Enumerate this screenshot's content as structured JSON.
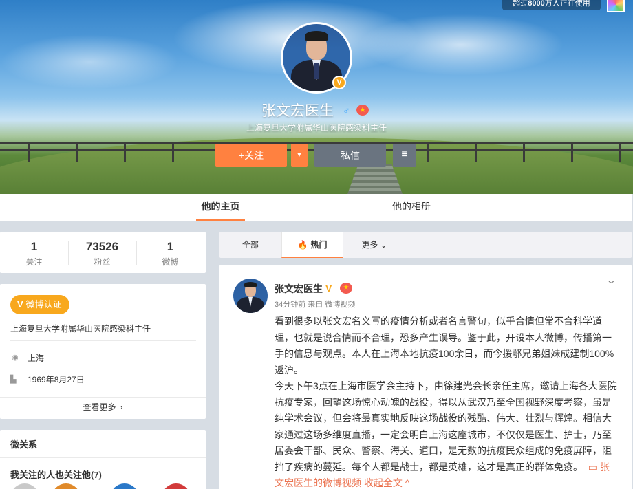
{
  "banner": {
    "usage_badge_pre": "超过",
    "usage_badge_num": "8000",
    "usage_badge_post": "万人正在使用"
  },
  "profile": {
    "name": "张文宏医生",
    "verify_mark": "V",
    "gender": "♂",
    "description": "上海复旦大学附属华山医院感染科主任",
    "follow_label": "+关注",
    "follow_dropdown": "▼",
    "message_label": "私信",
    "more_label": "≡"
  },
  "tabs": {
    "home": "他的主页",
    "album": "他的相册"
  },
  "stats": [
    {
      "num": "1",
      "label": "关注"
    },
    {
      "num": "73526",
      "label": "粉丝"
    },
    {
      "num": "1",
      "label": "微博"
    }
  ],
  "info": {
    "verified_mark": "V",
    "verified_label": "微博认证",
    "org": "上海复旦大学附属华山医院感染科主任",
    "location": "上海",
    "birthday": "1969年8月27日",
    "more": "查看更多",
    "more_chevron": "›"
  },
  "relation": {
    "title": "微关系",
    "subtitle": "我关注的人也关注他(7)"
  },
  "feed_tabs": {
    "all": "全部",
    "hot": "热门",
    "hot_icon": "🔥",
    "more": "更多",
    "more_chevron": "⌄"
  },
  "post": {
    "author": "张文宏医生",
    "verify_mark": "V",
    "meta": "34分钟前 来自 微博视频",
    "para1": "看到很多以张文宏名义写的疫情分析或者名言警句，似乎合情但常不合科学道理，也就是说合情而不合理，恐多产生误导。鉴于此，开设本人微博，传播第一手的信息与观点。本人在上海本地抗疫100余日，而今援鄂兄弟姐妹成建制100%返沪。",
    "para2": "今天下午3点在上海市医学会主持下，由徐建光会长亲任主席，邀请上海各大医院抗疫专家，回望这场惊心动魄的战役，得以从武汉乃至全国视野深度考察，虽是纯学术会议，但会将最真实地反映这场战役的残酷、伟大、壮烈与辉煌。相信大家通过这场多维度直播，一定会明白上海这座城市，不仅仅是医生、护士，乃至居委会干部、民众、警察、海关、道口，是无数的抗疫民众组成的免疫屏障，阻挡了疾病的蔓延。每个人都是战士，都是英雄，这才是真正的群体免疫。",
    "video_link": "张文宏医生的微博视频",
    "video_icon": "▭",
    "collapse": "收起全文 ^"
  },
  "colors": {
    "accent": "#ff8140",
    "verified": "#f8a81d",
    "link": "#eb7350"
  }
}
